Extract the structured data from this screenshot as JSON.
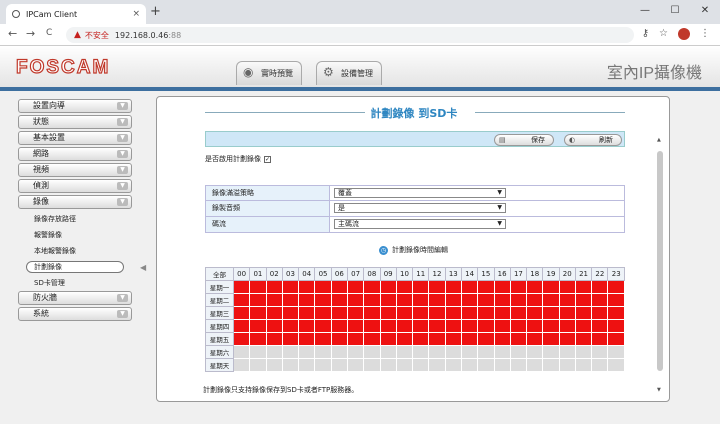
{
  "browser": {
    "tab_title": "IPCam Client",
    "tab_close": "×",
    "new_tab": "+",
    "min": "—",
    "max": "☐",
    "close": "✕",
    "back": "←",
    "forward": "→",
    "reload": "C",
    "insecure_label": "不安全",
    "url_host": "192.168.0.46",
    "url_port": ":88"
  },
  "header": {
    "logo": "FOSCAM",
    "product": "室內IP攝像機",
    "tabs": [
      {
        "label": "實時預覽"
      },
      {
        "label": "設備管理"
      }
    ]
  },
  "sidebar": {
    "items": [
      {
        "label": "設置向導"
      },
      {
        "label": "狀態"
      },
      {
        "label": "基本設置"
      },
      {
        "label": "網路"
      },
      {
        "label": "視頻"
      },
      {
        "label": "偵測"
      },
      {
        "label": "錄像"
      }
    ],
    "record_sub": [
      {
        "label": "錄像存放路徑"
      },
      {
        "label": "報警錄像"
      },
      {
        "label": "本地報警錄像"
      },
      {
        "label": "計劃錄像"
      },
      {
        "label": "SD卡管理"
      }
    ],
    "items_after": [
      {
        "label": "防火牆"
      },
      {
        "label": "系統"
      }
    ]
  },
  "main": {
    "title": "計劃錄像 到SD卡",
    "save": "保存",
    "refresh": "刷新",
    "enable_label": "是否啟用計劃錄像",
    "enable_check": "✓",
    "form": [
      {
        "label": "錄像滿溢策略",
        "value": "覆蓋"
      },
      {
        "label": "錄製音頻",
        "value": "是"
      },
      {
        "label": "碼流",
        "value": "主碼流"
      }
    ],
    "edit_link": "計劃錄像時間編輯",
    "schedule": {
      "all": "全部",
      "hours": [
        "00",
        "01",
        "02",
        "03",
        "04",
        "05",
        "06",
        "07",
        "08",
        "09",
        "10",
        "11",
        "12",
        "13",
        "14",
        "15",
        "16",
        "17",
        "18",
        "19",
        "20",
        "21",
        "22",
        "23"
      ],
      "days": [
        {
          "label": "星期一",
          "on": true
        },
        {
          "label": "星期二",
          "on": true
        },
        {
          "label": "星期三",
          "on": true
        },
        {
          "label": "星期四",
          "on": true
        },
        {
          "label": "星期五",
          "on": true
        },
        {
          "label": "星期六",
          "on": false
        },
        {
          "label": "星期天",
          "on": false
        }
      ]
    },
    "note": "計劃錄像只支持錄像保存到SD卡或者FTP服務器。"
  }
}
